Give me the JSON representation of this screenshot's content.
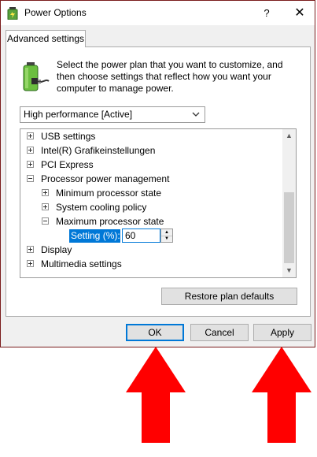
{
  "window": {
    "title": "Power Options",
    "help": "?",
    "close": "✕"
  },
  "tab": {
    "label": "Advanced settings"
  },
  "intro": "Select the power plan that you want to customize, and then choose settings that reflect how you want your computer to manage power.",
  "plan_select": {
    "value": "High performance [Active]"
  },
  "tree": {
    "items": [
      {
        "label": "USB settings"
      },
      {
        "label": "Intel(R) Grafikeinstellungen"
      },
      {
        "label": "PCI Express"
      },
      {
        "label": "Processor power management"
      },
      {
        "label": "Minimum processor state"
      },
      {
        "label": "System cooling policy"
      },
      {
        "label": "Maximum processor state"
      },
      {
        "label": "Display"
      },
      {
        "label": "Multimedia settings"
      }
    ],
    "setting": {
      "label": "Setting (%):",
      "value": "60"
    }
  },
  "buttons": {
    "restore": "Restore plan defaults",
    "ok": "OK",
    "cancel": "Cancel",
    "apply": "Apply"
  },
  "colors": {
    "selection": "#0078d7",
    "arrow": "#ff0000",
    "frame": "#7a1c1c"
  }
}
